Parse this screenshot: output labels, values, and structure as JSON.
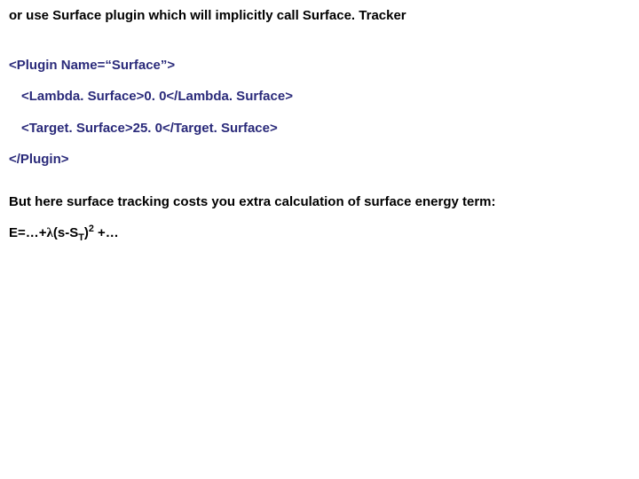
{
  "title": "or use Surface plugin which will implicitly call Surface. Tracker",
  "xml": {
    "open": "<Plugin Name=“Surface”>",
    "lambda": "<Lambda. Surface>0. 0</Lambda. Surface>",
    "target": "<Target. Surface>25. 0</Target. Surface>",
    "close": "</Plugin>"
  },
  "note": "But here surface tracking costs you extra calculation of surface energy term:",
  "formula": {
    "prefix": "E=…+",
    "lambda": "λ",
    "mid1": "(s-S",
    "sub": "T",
    "mid2": ")",
    "sup": "2",
    "suffix": " +…"
  }
}
